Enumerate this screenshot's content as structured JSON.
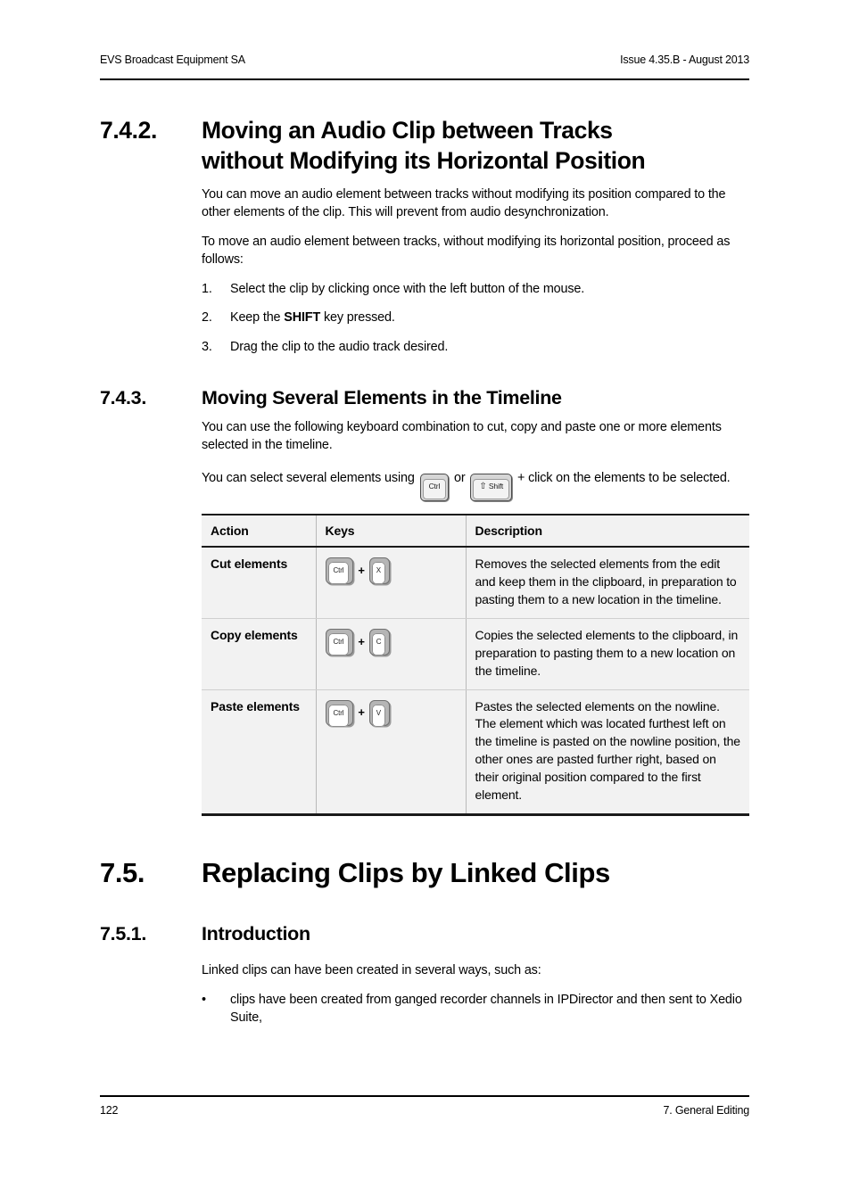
{
  "header": {
    "left": "EVS Broadcast Equipment SA",
    "right": "Issue 4.35.B - August 2013"
  },
  "footer": {
    "page_number": "122",
    "chapter": "7. General Editing"
  },
  "sections": {
    "s742": {
      "number": "7.4.2.",
      "title_line1": "Moving an Audio Clip between Tracks",
      "title_line2": "without Modifying its Horizontal Position",
      "para1": "You can move an audio element between tracks without modifying its position compared to the other elements of the clip. This will prevent from audio desynchronization.",
      "para2": "To move an audio element between tracks, without modifying its horizontal position, proceed as follows:",
      "steps": [
        {
          "marker": "1.",
          "text": "Select the clip by clicking once with the left button of the mouse."
        },
        {
          "marker": "2.",
          "text_before": "Keep the ",
          "bold": "SHIFT",
          "text_after": " key pressed."
        },
        {
          "marker": "3.",
          "text": "Drag the clip to the audio track desired."
        }
      ]
    },
    "s743": {
      "number": "7.4.3.",
      "title": "Moving Several Elements in the Timeline",
      "para1": "You can use the following keyboard combination to cut, copy and paste one or more elements selected in the timeline.",
      "para2_before": "You can select several elements using ",
      "para2_or": "or",
      "para2_after": "+ click on the elements to be selected.",
      "inline_keys": {
        "ctrl": "Ctrl",
        "shift_arrow": "⇧",
        "shift": "Shift"
      }
    },
    "s75": {
      "number": "7.5.",
      "title": "Replacing Clips by Linked Clips"
    },
    "s751": {
      "number": "7.5.1.",
      "title": "Introduction",
      "para1": "Linked clips can have been created in several ways, such as:",
      "bullets": [
        {
          "marker": "•",
          "text": "clips have been created from ganged recorder channels in IPDirector and then sent to Xedio Suite,"
        }
      ]
    }
  },
  "table": {
    "headers": [
      "Action",
      "Keys",
      "Description"
    ],
    "rows": [
      {
        "action": "Cut elements",
        "key_mod": "Ctrl",
        "key_plus": "+",
        "key_letter": "X",
        "description": "Removes the selected elements from the edit and keep them in the clipboard, in preparation to pasting them to a new location in the timeline."
      },
      {
        "action": "Copy elements",
        "key_mod": "Ctrl",
        "key_plus": "+",
        "key_letter": "C",
        "description": "Copies the selected elements to the clipboard, in preparation to pasting them to a new location on the timeline."
      },
      {
        "action": "Paste elements",
        "key_mod": "Ctrl",
        "key_plus": "+",
        "key_letter": "V",
        "description": "Pastes the selected elements on the nowline. The element which was located furthest left on the timeline is pasted on the nowline position, the other ones are pasted further right, based on their original position compared to the first element."
      }
    ]
  }
}
